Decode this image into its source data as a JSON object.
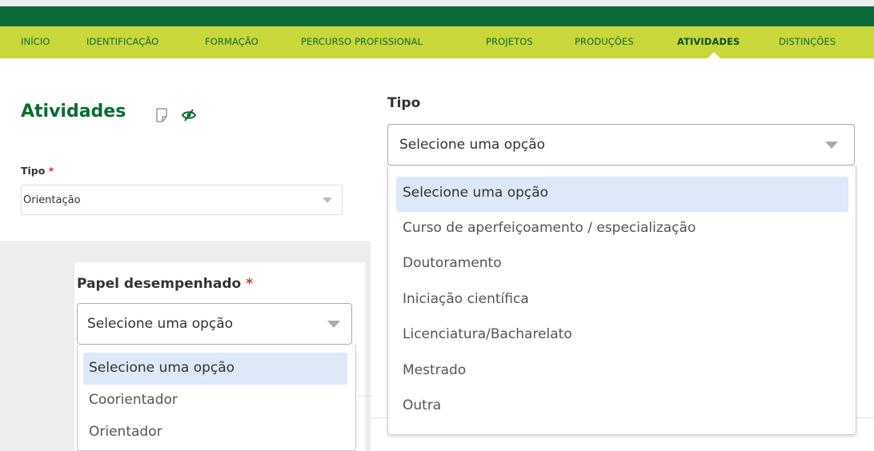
{
  "nav": {
    "items": [
      {
        "label": "INÍCIO"
      },
      {
        "label": "IDENTIFICAÇÃO"
      },
      {
        "label": "FORMAÇÃO"
      },
      {
        "label": "PERCURSO PROFISSIONAL"
      },
      {
        "label": "PROJETOS"
      },
      {
        "label": "PRODUÇÕES"
      },
      {
        "label": "ATIVIDADES",
        "active": true
      },
      {
        "label": "DISTINÇÕES"
      }
    ]
  },
  "page": {
    "title": "Atividades",
    "tipo_label": "Tipo",
    "tipo_required": "*",
    "tipo_value": "Orientação"
  },
  "tipo_dropdown": {
    "label": "Tipo",
    "value": "Selecione uma opção",
    "options": [
      "Selecione uma opção",
      "Curso de aperfeiçoamento / especialização",
      "Doutoramento",
      "Iniciação científica",
      "Licenciatura/Bacharelato",
      "Mestrado",
      "Outra"
    ]
  },
  "papel_dropdown": {
    "label": "Papel desempenhado",
    "required": "*",
    "value": "Selecione uma opção",
    "options": [
      "Selecione uma opção",
      "Coorientador",
      "Orientador"
    ]
  },
  "colors": {
    "dark_green": "#0a6b37",
    "lime": "#c9d73a",
    "highlight": "#dde8f8"
  },
  "icons": [
    "doc-icon",
    "eye-slash-icon",
    "chevron-down-icon"
  ]
}
